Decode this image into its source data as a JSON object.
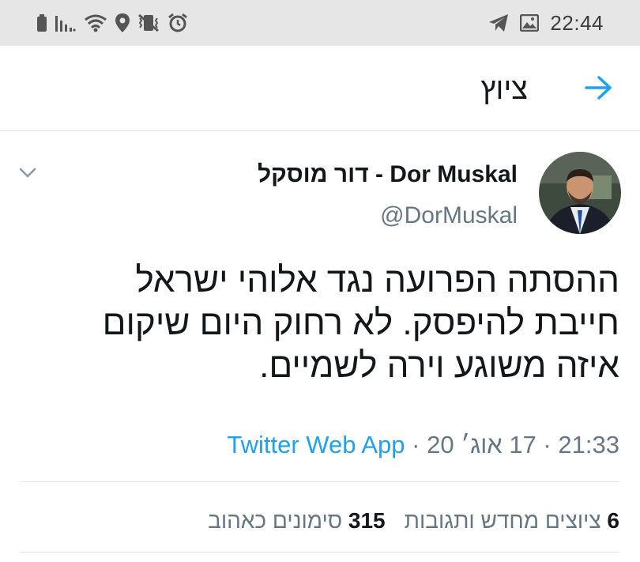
{
  "status_bar": {
    "time": "22:44",
    "left_icons": [
      "battery-icon",
      "signal-icon",
      "wifi-icon",
      "location-icon",
      "vibrate-mute-icon",
      "alarm-icon"
    ],
    "right_icons": [
      "telegram-icon",
      "gallery-icon"
    ]
  },
  "header": {
    "title": "ציוץ",
    "back_icon": "arrow-back-icon"
  },
  "tweet": {
    "display_name": "Dor Muskal - דור מוסקל",
    "handle": "@DorMuskal",
    "text_lines": [
      "ההסתה הפרועה נגד אלוהי ישראל",
      "חייבת להיפסק. לא רחוק היום שיקום",
      "איזה משוגע וירה לשמיים."
    ],
    "time": "21:33",
    "date": "17 אוג׳ 20",
    "separator": "·",
    "source": "Twitter Web App",
    "retweets_count": "6",
    "retweets_label": "ציוצים מחדש ותגובות",
    "likes_count": "315",
    "likes_label": "סימונים כאהוב"
  },
  "colors": {
    "accent": "#1da1f2",
    "secondary_text": "#657786",
    "divider": "#e1e8ed",
    "status_bar_bg": "#e6e6e6"
  }
}
